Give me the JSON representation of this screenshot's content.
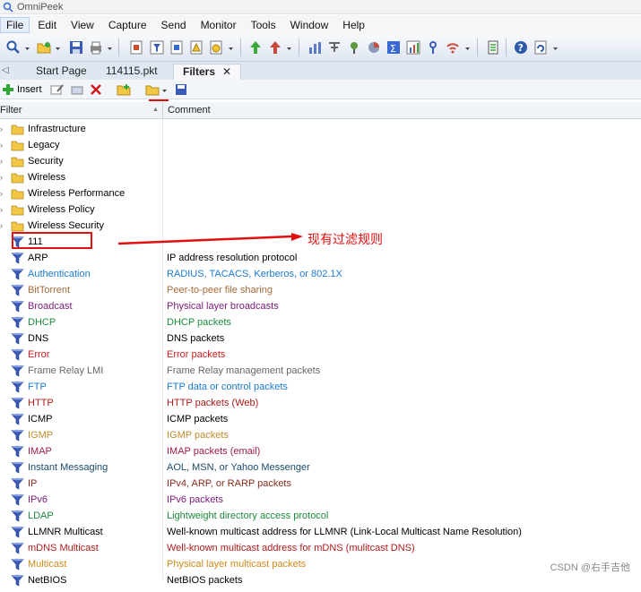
{
  "app": {
    "title": "OmniPeek"
  },
  "menu": {
    "items": [
      "File",
      "Edit",
      "View",
      "Capture",
      "Send",
      "Monitor",
      "Tools",
      "Window",
      "Help"
    ]
  },
  "tabs": {
    "items": [
      {
        "label": "Start Page"
      },
      {
        "label": "114115.pkt"
      },
      {
        "label": "Filters",
        "close": "✕"
      }
    ]
  },
  "filter_toolbar": {
    "insert_label": "Insert"
  },
  "table": {
    "headers": {
      "filter": "Filter",
      "comment": "Comment"
    },
    "folders": [
      {
        "name": "Infrastructure"
      },
      {
        "name": "Legacy"
      },
      {
        "name": "Security"
      },
      {
        "name": "Wireless"
      },
      {
        "name": "Wireless Performance"
      },
      {
        "name": "Wireless Policy"
      },
      {
        "name": "Wireless Security"
      }
    ],
    "filters": [
      {
        "name": "111",
        "comment": "",
        "color": "#000000"
      },
      {
        "name": "ARP",
        "comment": "IP address resolution protocol",
        "color": "#000000"
      },
      {
        "name": "Authentication",
        "comment": "RADIUS, TACACS, Kerberos, or 802.1X",
        "color": "#1a7ad4"
      },
      {
        "name": "BitTorrent",
        "comment": "Peer-to-peer file sharing",
        "color": "#a86a38"
      },
      {
        "name": "Broadcast",
        "comment": "Physical layer broadcasts",
        "color": "#7a1a7a"
      },
      {
        "name": "DHCP",
        "comment": "DHCP packets",
        "color": "#1a8a3a"
      },
      {
        "name": "DNS",
        "comment": "DNS packets",
        "color": "#000000"
      },
      {
        "name": "Error",
        "comment": "Error packets",
        "color": "#d01a1a"
      },
      {
        "name": "Frame Relay LMI",
        "comment": "Frame Relay management packets",
        "color": "#666666"
      },
      {
        "name": "FTP",
        "comment": "FTP data or control packets",
        "color": "#1a7ad4"
      },
      {
        "name": "HTTP",
        "comment": "HTTP packets (Web)",
        "color": "#b01a1a"
      },
      {
        "name": "ICMP",
        "comment": "ICMP packets",
        "color": "#000000"
      },
      {
        "name": "IGMP",
        "comment": "IGMP packets",
        "color": "#c08a2a"
      },
      {
        "name": "IMAP",
        "comment": "IMAP packets (email)",
        "color": "#a01a4a"
      },
      {
        "name": "Instant Messaging",
        "comment": "AOL, MSN, or Yahoo Messenger",
        "color": "#1a4a6a"
      },
      {
        "name": "IP",
        "comment": "IPv4, ARP, or RARP packets",
        "color": "#8a2a1a"
      },
      {
        "name": "IPv6",
        "comment": "IPv6 packets",
        "color": "#7a1a7a"
      },
      {
        "name": "LDAP",
        "comment": "Lightweight directory access protocol",
        "color": "#1a8a3a"
      },
      {
        "name": "LLMNR Multicast",
        "comment": "Well-known multicast address for LLMNR (Link-Local Multicast Name Resolution)",
        "color": "#000000"
      },
      {
        "name": "mDNS Multicast",
        "comment": "Well-known multicast address for mDNS (mulitcast DNS)",
        "color": "#b01a1a"
      },
      {
        "name": "Multicast",
        "comment": "Physical layer multicast packets",
        "color": "#d08a1a"
      },
      {
        "name": "NetBIOS",
        "comment": "NetBIOS packets",
        "color": "#000000"
      }
    ]
  },
  "annotation": {
    "text": "现有过滤规则"
  },
  "watermark": {
    "text": "CSDN @右手吉他"
  },
  "icons": {
    "folder": "folder-icon",
    "filter": "funnel-icon",
    "insert": "plus-icon"
  },
  "colors": {
    "accent_red": "#e01010",
    "folder_yellow": "#f2c744",
    "funnel_blue": "#3a5bb8"
  }
}
